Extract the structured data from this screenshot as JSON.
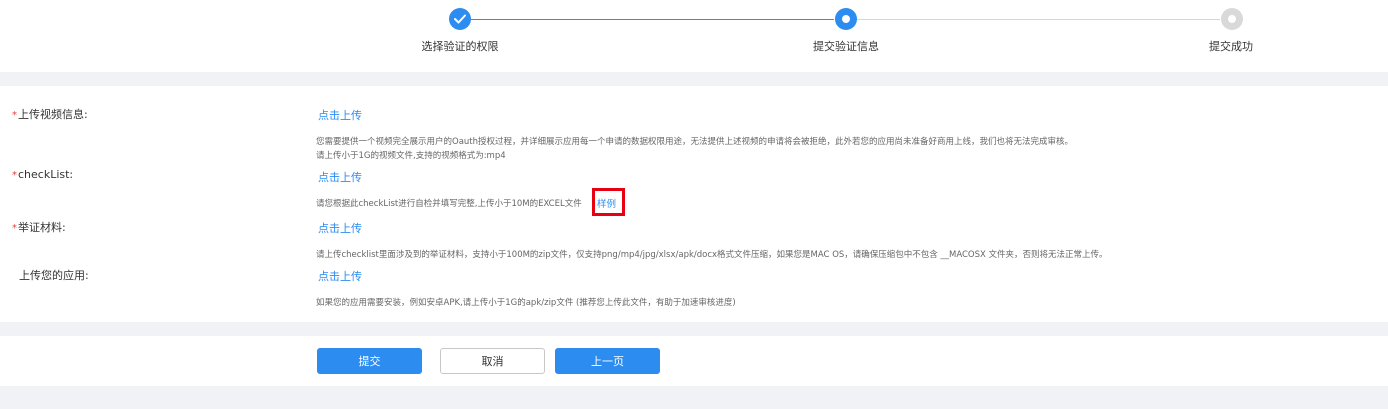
{
  "steps": {
    "items": [
      {
        "label": "选择验证的权限",
        "status": "done"
      },
      {
        "label": "提交验证信息",
        "status": "active"
      },
      {
        "label": "提交成功",
        "status": "todo"
      }
    ]
  },
  "form": {
    "video": {
      "required_mark": "*",
      "label": "上传视频信息:",
      "upload_label": "点击上传",
      "hint1": "您需要提供一个视频完全展示用户的Oauth授权过程，并详细展示应用每一个申请的数据权限用途，无法提供上述视频的申请将会被拒绝，此外若您的应用尚未准备好商用上线，我们也将无法完成审核。",
      "hint2": "请上传小于1G的视频文件,支持的视频格式为:mp4"
    },
    "checklist": {
      "required_mark": "*",
      "label": "checkList:",
      "upload_label": "点击上传",
      "hint": "请您根据此checkList进行自检并填写完整,上传小于10M的EXCEL文件",
      "sample_label": "样例"
    },
    "proof": {
      "required_mark": "*",
      "label": "举证材料:",
      "upload_label": "点击上传",
      "hint": "请上传checklist里面涉及到的举证材料，支持小于100M的zip文件，仅支持png/mp4/jpg/xlsx/apk/docx格式文件压缩，如果您是MAC OS，请确保压缩包中不包含 __MACOSX 文件夹，否则将无法正常上传。"
    },
    "app": {
      "label": "上传您的应用:",
      "upload_label": "点击上传",
      "hint": "如果您的应用需要安装，例如安卓APK,请上传小于1G的apk/zip文件 (推荐您上传此文件，有助于加速审核进度)"
    }
  },
  "buttons": {
    "submit": "提交",
    "cancel": "取消",
    "prev": "上一页"
  },
  "colors": {
    "primary": "#2d8cf0",
    "required": "#e8413b",
    "highlight_box": "#e60012",
    "inactive": "#d9d9d9"
  }
}
